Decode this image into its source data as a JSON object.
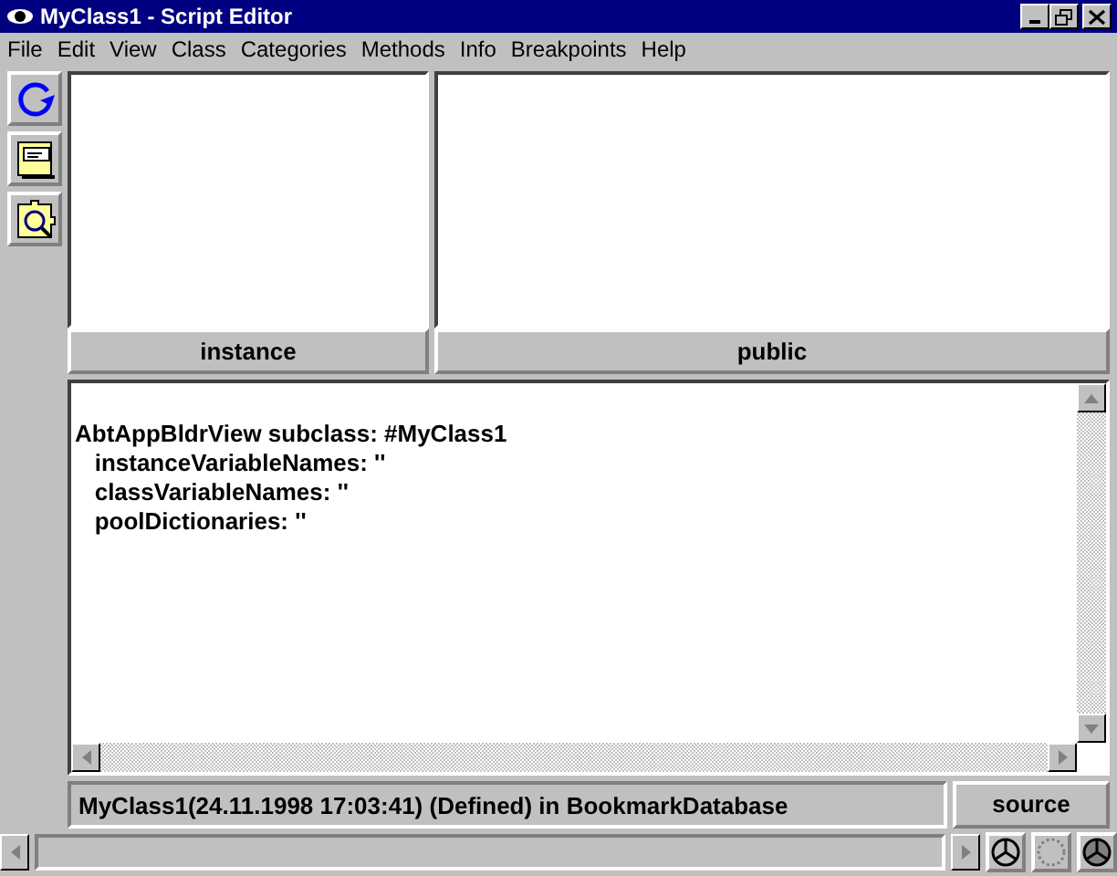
{
  "window": {
    "title": "MyClass1 - Script Editor"
  },
  "menu": [
    "File",
    "Edit",
    "View",
    "Class",
    "Categories",
    "Methods",
    "Info",
    "Breakpoints",
    "Help"
  ],
  "toolbar": [
    {
      "kind": "refresh"
    },
    {
      "kind": "comment"
    },
    {
      "kind": "puzzle"
    }
  ],
  "panes": [
    {
      "header": "instance"
    },
    {
      "header": "public"
    }
  ],
  "editor": {
    "lines": [
      "AbtAppBldrView subclass: #MyClass1",
      "   instanceVariableNames: ''",
      "   classVariableNames: ''",
      "   poolDictionaries: ''"
    ]
  },
  "status": {
    "text": "MyClass1(24.11.1998 17:03:41) (Defined) in BookmarkDatabase",
    "button": "source"
  },
  "bottom_icons": [
    {
      "kind": "wheel"
    },
    {
      "kind": "dotted"
    },
    {
      "kind": "wheel-filled"
    }
  ]
}
